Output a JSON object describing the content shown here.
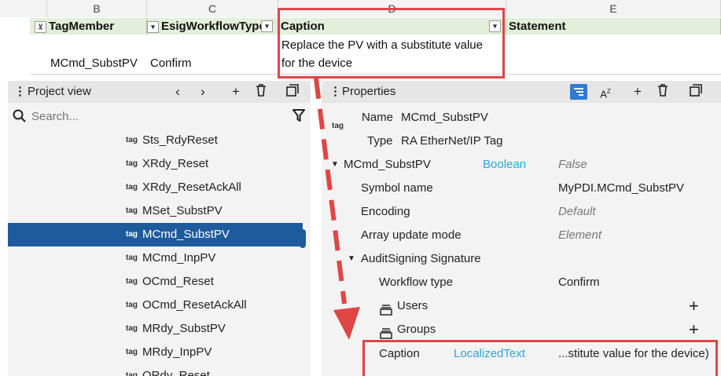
{
  "sheet": {
    "columns": [
      "B",
      "C",
      "D",
      "E"
    ],
    "headers": {
      "tag_member": "TagMember",
      "esig_workflow": "EsigWorkflowType",
      "caption": "Caption",
      "statement": "Statement"
    },
    "row": {
      "tag_member": "MCmd_SubstPV",
      "esig_workflow": "Confirm",
      "caption_line1": "Replace the PV with a substitute value",
      "caption_line2": "for the device"
    }
  },
  "project_view": {
    "title": "Project view",
    "search_placeholder": "Search...",
    "tag_label": "tag",
    "items": [
      "Sts_RdyReset",
      "XRdy_Reset",
      "XRdy_ResetAckAll",
      "MSet_SubstPV",
      "MCmd_SubstPV",
      "MCmd_InpPV",
      "OCmd_Reset",
      "OCmd_ResetAckAll",
      "MRdy_SubstPV",
      "MRdy_InpPV",
      "ORdy_Reset"
    ],
    "selected": "MCmd_SubstPV"
  },
  "properties": {
    "title": "Properties",
    "tag_label": "tag",
    "name_label": "Name",
    "name_value": "MCmd_SubstPV",
    "type_label": "Type",
    "type_value": "RA EtherNet/IP Tag",
    "group_name": "MCmd_SubstPV",
    "group_type": "Boolean",
    "group_value": "False",
    "rows": [
      {
        "label": "Symbol name",
        "type": "",
        "value": "MyPDI.MCmd_SubstPV"
      },
      {
        "label": "Encoding",
        "type": "",
        "value": "Default"
      },
      {
        "label": "Array update mode",
        "type": "",
        "value": "Element"
      }
    ],
    "audit_group": "AuditSigning Signature",
    "workflow_label": "Workflow type",
    "workflow_value": "Confirm",
    "users_label": "Users",
    "groups_label": "Groups",
    "caption_label": "Caption",
    "caption_type": "LocalizedText",
    "caption_value": "...stitute value for the device)"
  },
  "colors": {
    "selection": "#1e5b9c",
    "accent": "#2ea5d9",
    "highlight": "#e04545",
    "header_green": "#e2efda"
  }
}
